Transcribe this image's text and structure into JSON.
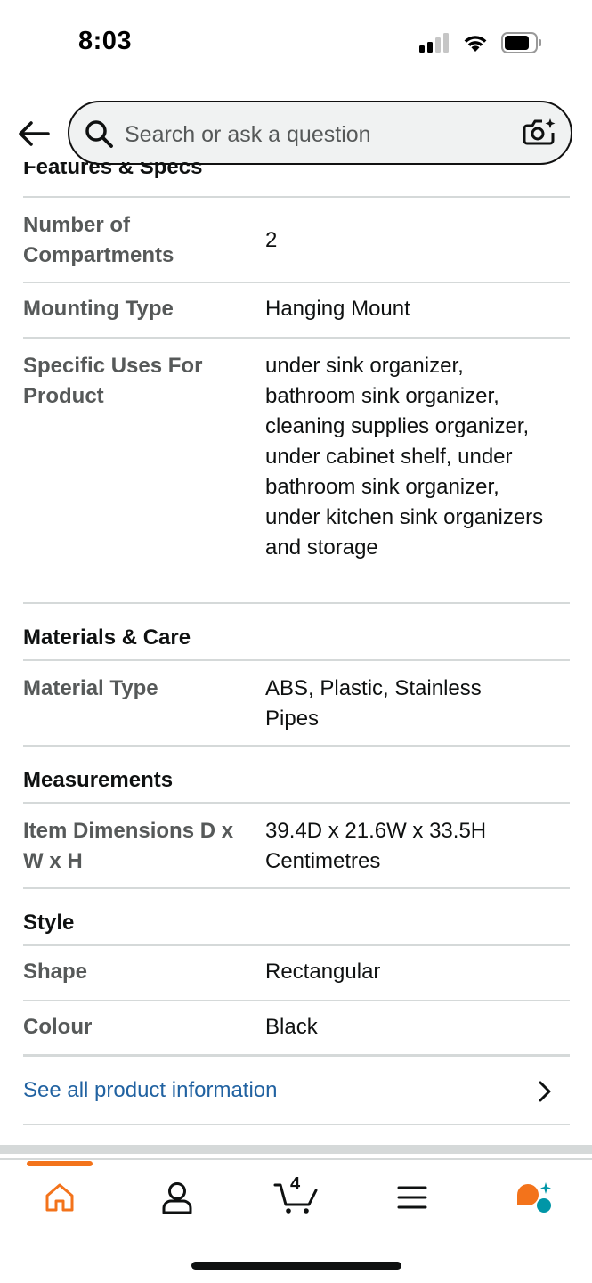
{
  "status_bar": {
    "time": "8:03"
  },
  "search": {
    "placeholder": "Search or ask a question"
  },
  "cut_section": {
    "title": "Features & Specs"
  },
  "specs": [
    {
      "label": "Number of Compartments",
      "value": "2"
    },
    {
      "label": "Mounting Type",
      "value": "Hanging Mount"
    },
    {
      "label": "Specific Uses For Product",
      "value": "under sink organizer, bathroom sink organizer, cleaning supplies organizer, under cabinet shelf, under bathroom sink organizer, under kitchen sink organizers and storage"
    }
  ],
  "materials": {
    "title": "Materials & Care",
    "rows": [
      {
        "label": "Material Type",
        "value": "ABS, Plastic, Stainless Pipes"
      }
    ]
  },
  "measurements": {
    "title": "Measurements",
    "rows": [
      {
        "label": "Item Dimensions D x W x H",
        "value": "39.4D x 21.6W x 33.5H Centimetres"
      }
    ]
  },
  "style": {
    "title": "Style",
    "rows": [
      {
        "label": "Shape",
        "value": "Rectangular"
      },
      {
        "label": "Colour",
        "value": "Black"
      }
    ]
  },
  "see_all": {
    "label": "See all product information"
  },
  "bottom_nav": {
    "cart_count": "4",
    "active": "home",
    "items": [
      "home-icon",
      "account-icon",
      "cart-icon",
      "menu-icon",
      "rufus-icon"
    ]
  },
  "colors": {
    "accent": "#f3731b",
    "link": "#2162a1",
    "divider": "#d5d9d9",
    "muted": "#565959"
  }
}
